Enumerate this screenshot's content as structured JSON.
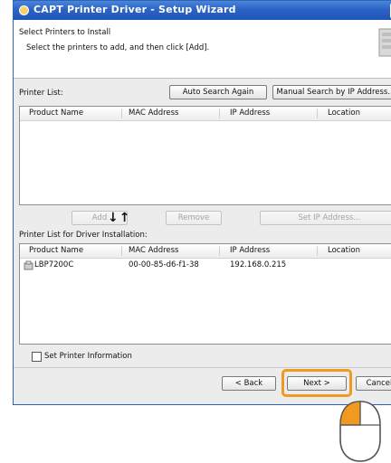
{
  "window": {
    "title": "CAPT Printer Driver - Setup Wizard"
  },
  "header": {
    "title": "Select Printers to Install",
    "subtitle": "Select the printers to add, and then click [Add]."
  },
  "printer_list": {
    "label": "Printer List:",
    "columns": [
      "Product Name",
      "MAC Address",
      "IP Address",
      "Location"
    ],
    "rows": []
  },
  "buttons": {
    "auto_search": "Auto Search Again",
    "manual_search": "Manual Search by IP Address...",
    "add": "Add",
    "remove": "Remove",
    "set_ip": "Set IP Address...",
    "back": "< Back",
    "next": "Next >",
    "cancel": "Cancel"
  },
  "install_list": {
    "label": "Printer List for Driver Installation:",
    "columns": [
      "Product Name",
      "MAC Address",
      "IP Address",
      "Location"
    ],
    "rows": [
      {
        "product": "LBP7200C",
        "mac": "00-00-85-d6-f1-38",
        "ip": "192.168.0.215",
        "location": ""
      }
    ]
  },
  "set_printer_info": {
    "label": "Set Printer Information",
    "checked": false
  },
  "arrows_glyph": "↓↑",
  "colors": {
    "highlight": "#f29a1f",
    "titlebar": "#2b63c6"
  },
  "icons": [
    "printer-icon",
    "setup-logo-icon",
    "close-icon",
    "mouse-icon"
  ]
}
